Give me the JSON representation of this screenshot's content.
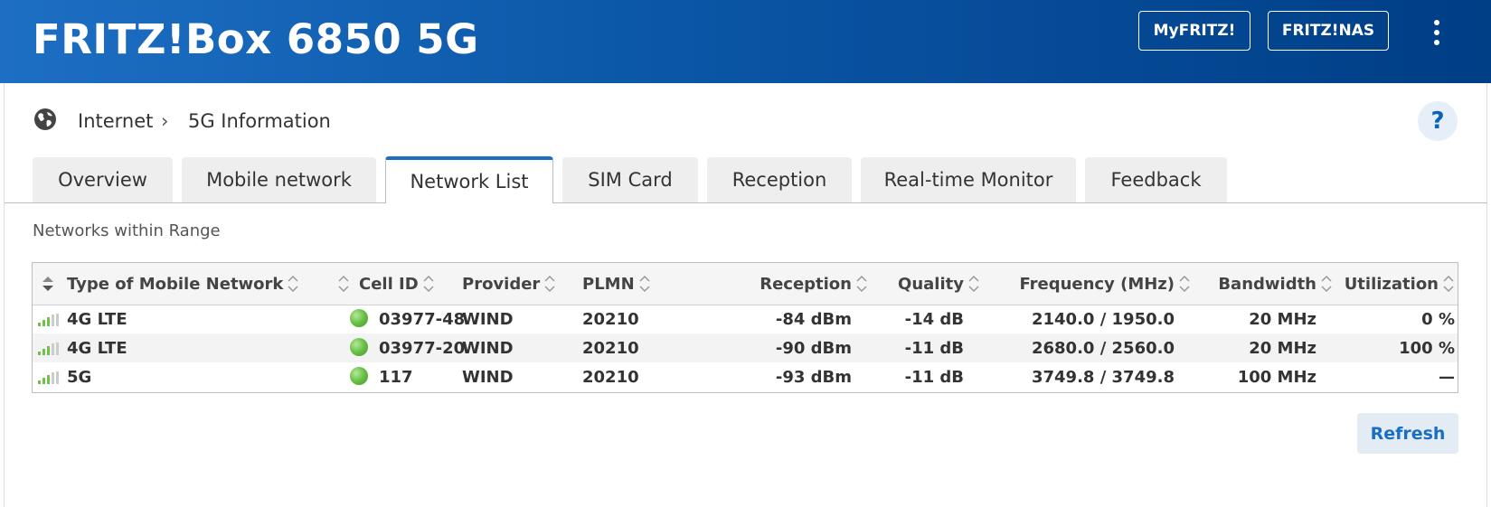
{
  "header": {
    "title": "FRITZ!Box 6850 5G",
    "buttons": [
      {
        "label": "MyFRITZ!"
      },
      {
        "label": "FRITZ!NAS"
      }
    ],
    "menu_icon": "kebab-menu-icon",
    "gradient_start": "#1d6fc4",
    "gradient_end": "#003e86"
  },
  "breadcrumb": {
    "icon": "globe-icon",
    "items": [
      "Internet",
      "5G Information"
    ],
    "separator": "›",
    "help_label": "?"
  },
  "tabs": [
    {
      "label": "Overview",
      "active": false
    },
    {
      "label": "Mobile network",
      "active": false
    },
    {
      "label": "Network List",
      "active": true
    },
    {
      "label": "SIM Card",
      "active": false
    },
    {
      "label": "Reception",
      "active": false
    },
    {
      "label": "Real-time Monitor",
      "active": false
    },
    {
      "label": "Feedback",
      "active": false
    }
  ],
  "section_title": "Networks within Range",
  "table": {
    "columns": [
      "Type of Mobile Network",
      "Cell ID",
      "Provider",
      "PLMN",
      "Reception",
      "Quality",
      "Frequency (MHz)",
      "Bandwidth",
      "Utilization"
    ],
    "rows": [
      {
        "type": "4G LTE",
        "cell_id": "03977-48",
        "provider": "WIND",
        "plmn": "20210",
        "reception": "-84 dBm",
        "quality": "-14 dB",
        "frequency": "2140.0 / 1950.0",
        "bandwidth": "20 MHz",
        "utilization": "0 %"
      },
      {
        "type": "4G LTE",
        "cell_id": "03977-20",
        "provider": "WIND",
        "plmn": "20210",
        "reception": "-90 dBm",
        "quality": "-11 dB",
        "frequency": "2680.0 / 2560.0",
        "bandwidth": "20 MHz",
        "utilization": "100 %"
      },
      {
        "type": "5G",
        "cell_id": "117",
        "provider": "WIND",
        "plmn": "20210",
        "reception": "-93 dBm",
        "quality": "-11 dB",
        "frequency": "3749.8 / 3749.8",
        "bandwidth": "100 MHz",
        "utilization": "—"
      }
    ],
    "status_color": "#6cc24a",
    "signal_icon": "signal-strength-icon"
  },
  "refresh_label": "Refresh",
  "colors": {
    "accent": "#1b6fc2"
  }
}
